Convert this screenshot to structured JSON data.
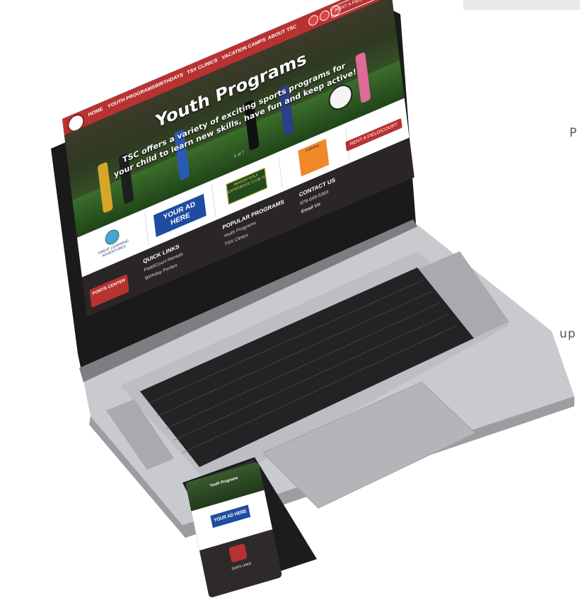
{
  "laptop": {
    "nav": {
      "items": [
        "HOME",
        "YOUTH PROGRAMS",
        "BIRTHDAYS",
        "TSX CLINICS",
        "VACATION CAMPS",
        "ABOUT TSC"
      ],
      "rent_button": "RENT A FIELD/COURT"
    },
    "hero": {
      "title": "Youth Programs",
      "subtitle": "TSC offers a variety of exciting sports programs for your child to learn new skills, have fun and keep active!",
      "pager": "4 of 7"
    },
    "ads": {
      "globe_text": "GREAT LEARNING ADVENTURES",
      "your_ad": "YOUR AD HERE",
      "club_text": "INDOOR GOLF EXPERIENCE CLUB 72",
      "orange_text": "Gateway"
    },
    "rent_bottom": "RENT A FIELD/COURT",
    "footer": {
      "logo": "PORTS CENTER",
      "quick_links_title": "QUICK LINKS",
      "quick_links": [
        "Field/Court Rentals",
        "Birthday Parties"
      ],
      "popular_title": "POPULAR PROGRAMS",
      "popular": [
        "Youth Programs",
        "TSX Clinics"
      ],
      "contact_title": "CONTACT US",
      "contact_phone": "978-649-5393",
      "contact_email": "Email Us"
    }
  },
  "phone": {
    "hero_text": "Youth Programs",
    "ad": "YOUR AD HERE",
    "quick_links": "QUICK LINKS"
  },
  "side_text": {
    "top": "P",
    "bottom": "up"
  }
}
